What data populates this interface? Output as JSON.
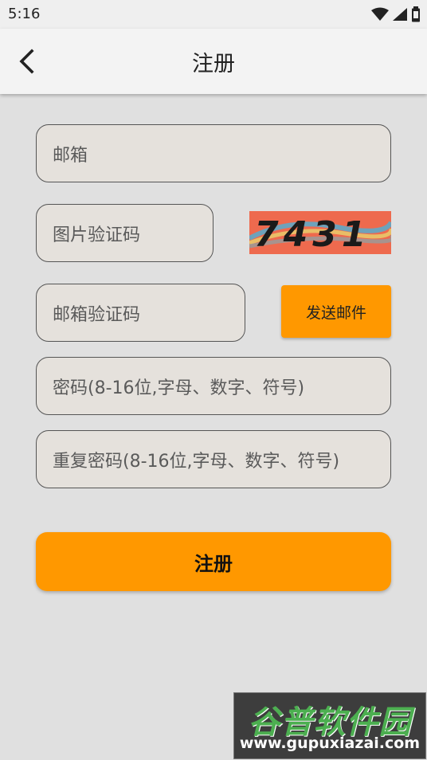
{
  "status_bar": {
    "time": "5:16",
    "icons": [
      "wifi-icon",
      "signal-icon",
      "battery-icon"
    ]
  },
  "app_bar": {
    "title": "注册",
    "back_icon": "chevron-left-icon"
  },
  "form": {
    "email_placeholder": "邮箱",
    "image_code_placeholder": "图片验证码",
    "captcha_text": "7431",
    "email_code_placeholder": "邮箱验证码",
    "send_email_label": "发送邮件",
    "password_placeholder": "密码(8-16位,字母、数字、符号)",
    "repeat_password_placeholder": "重复密码(8-16位,字母、数字、符号)",
    "register_label": "注册"
  },
  "watermark": {
    "brand": "谷普软件园",
    "url": "www.gupuxiazai.com"
  },
  "colors": {
    "accent": "#ff9800",
    "background": "#e0e0e0",
    "field_bg": "#e5e1dc",
    "captcha_bg": "#ee6a4e"
  }
}
